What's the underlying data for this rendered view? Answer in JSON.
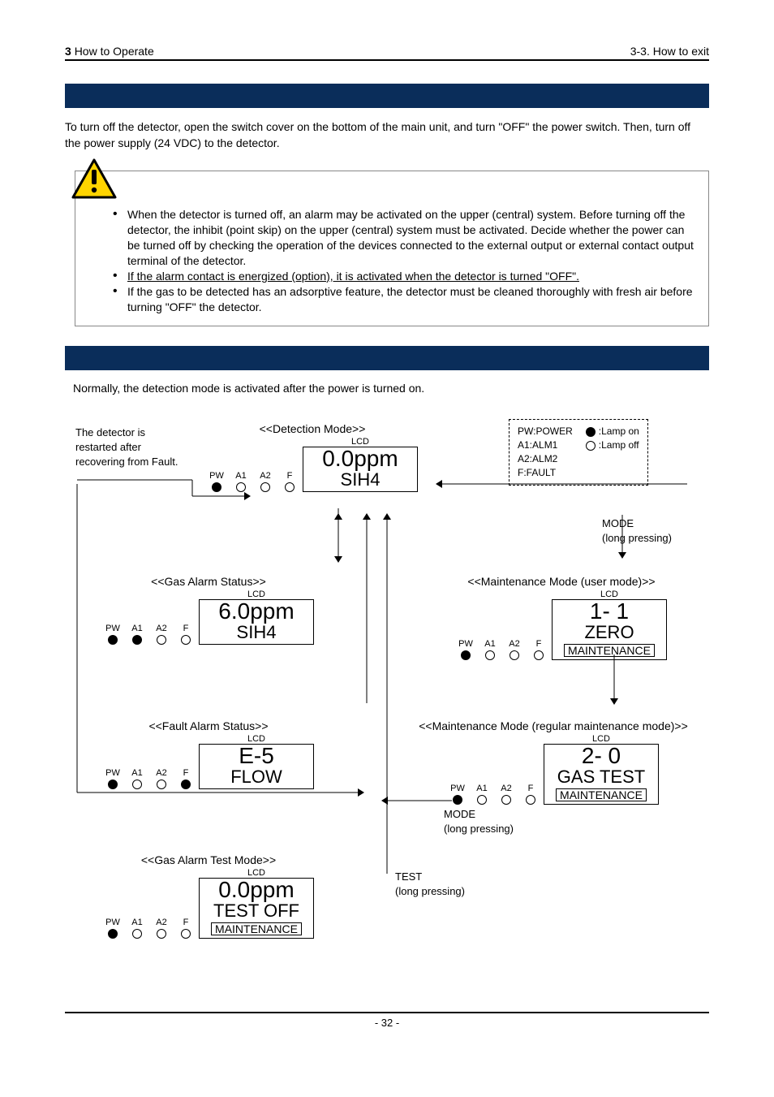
{
  "header": {
    "chapter_num": "3",
    "chapter_label": "How to Operate",
    "right": "3-3. How to exit"
  },
  "section1": {
    "paragraph": "To turn off the detector, open the switch cover on the bottom of the main unit, and turn \"OFF\" the power switch. Then, turn off the power supply (24 VDC) to the detector."
  },
  "caution": {
    "c1": "When the detector is turned off, an alarm may be activated on the upper (central) system. Before turning off the detector, the inhibit (point skip) on the upper (central) system must be activated. Decide whether the power can be turned off by checking the operation of the devices connected to the external output or external contact output terminal of the detector.",
    "c2": "If the alarm contact is energized (option), it is activated when the detector is turned \"OFF\".",
    "c3": "If the gas to be detected has an adsorptive feature, the detector must be cleaned thoroughly with fresh air before turning \"OFF\" the detector."
  },
  "section2": {
    "paragraph": "Normally, the detection mode is activated after the power is turned on."
  },
  "labels": {
    "PW": "PW",
    "A1": "A1",
    "A2": "A2",
    "F": "F",
    "LCD": "LCD"
  },
  "legend": {
    "pw": "PW:POWER",
    "a1": "A1:ALM1",
    "a2": "A2:ALM2",
    "f": "F:FAULT",
    "lamp_on": ":Lamp on",
    "lamp_off": ":Lamp off"
  },
  "side": {
    "fault_note": "The detector is restarted after recovering from Fault.",
    "mode_long": "MODE\n(long pressing)",
    "test_long": "TEST\n(long pressing)"
  },
  "modules": {
    "detection": {
      "title": "<<Detection Mode>>",
      "lamps": {
        "pw": true,
        "a1": false,
        "a2": false,
        "f": false
      },
      "lcd_line1": "0.0ppm",
      "lcd_line2": "SIH4"
    },
    "gas_alarm": {
      "title": "<<Gas Alarm Status>>",
      "lamps": {
        "pw": true,
        "a1": true,
        "a2": false,
        "f": false
      },
      "lcd_line1": "6.0ppm",
      "lcd_line2": "SIH4"
    },
    "maint_user": {
      "title": "<<Maintenance Mode (user mode)>>",
      "lamps": {
        "pw": true,
        "a1": false,
        "a2": false,
        "f": false
      },
      "lcd_line1": "1- 1",
      "lcd_line2": "ZERO",
      "badge": "MAINTENANCE"
    },
    "fault": {
      "title": "<<Fault Alarm Status>>",
      "lamps": {
        "pw": true,
        "a1": false,
        "a2": false,
        "f": true
      },
      "lcd_line1": "E-5",
      "lcd_line2": "FLOW"
    },
    "maint_reg": {
      "title": "<<Maintenance Mode (regular maintenance mode)>>",
      "lamps": {
        "pw": true,
        "a1": false,
        "a2": false,
        "f": false
      },
      "lcd_line1": "2- 0",
      "lcd_line2": "GAS TEST",
      "badge": "MAINTENANCE"
    },
    "gas_test": {
      "title": "<<Gas Alarm Test Mode>>",
      "lamps": {
        "pw": true,
        "a1": false,
        "a2": false,
        "f": false
      },
      "lcd_line1": "0.0ppm",
      "lcd_line2": "TEST OFF",
      "badge": "MAINTENANCE"
    }
  },
  "footer": {
    "page": "- 32 -"
  }
}
